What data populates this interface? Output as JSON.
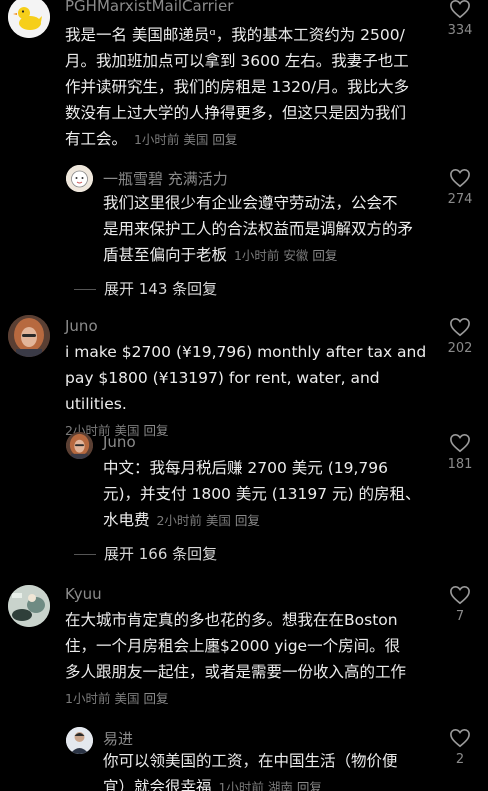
{
  "comments": [
    {
      "username": "PGHMarxistMailCarrier",
      "badge": "ᵅ",
      "text": "我是一名 美国邮递员ᵅ，我的基本工资约为 2500/月。我加班加点可以拿到 3600 左右。我妻子也工作并读研究生，我们的房租是 1320/月。我比大多数没有上过大学的人挣得更多，但这只是因为我们有工会。",
      "lines": [
        "我是一名 美国邮递员ᵅ，我的基本工资约为 2500/",
        "月。我加班加点可以拿到 3600 左右。我妻子也工",
        "作并读研究生，我们的房租是 1320/月。我比大多",
        "数没有上过大学的人挣得更多，但这只是因为我们"
      ],
      "last_line": "有工会。",
      "time": "1小时前",
      "location": "美国",
      "reply_label": "回复",
      "likes": "334"
    },
    {
      "username": "一瓶雪碧 充满活力",
      "lines": [
        "我们这里很少有企业会遵守劳动法，公会不",
        "是用来保护工人的合法权益而是调解双方的矛"
      ],
      "last_line": "盾甚至偏向于老板",
      "time": "1小时前",
      "location": "安徽",
      "reply_label": "回复",
      "likes": "274"
    },
    {
      "expand_label": "展开 143 条回复"
    },
    {
      "username": "Juno",
      "lines": [
        "i make $2700 (¥19,796) monthly after tax and",
        "pay $1800 (¥13197) for rent, water, and utilities."
      ],
      "time": "2小时前",
      "location": "美国",
      "reply_label": "回复",
      "likes": "202"
    },
    {
      "username": "Juno",
      "lines": [
        "中文：我每月税后赚 2700 美元 (19,796",
        "元)，并支付 1800 美元 (13197 元) 的房租、"
      ],
      "last_line": "水电费",
      "time": "2小时前",
      "location": "美国",
      "reply_label": "回复",
      "likes": "181"
    },
    {
      "expand_label": "展开 166 条回复"
    },
    {
      "username": "Kyuu",
      "lines": [
        "在大城市肯定真的多也花的多。想我在在Boston",
        "住，一个月房租会上廛$2000 yige一个房间。很",
        "多人跟朋友一起住，或者是需要一份收入高的工作"
      ],
      "time": "1小时前",
      "location": "美国",
      "reply_label": "回复",
      "likes": "7"
    },
    {
      "username": "易进",
      "lines": [
        "你可以领美国的工资，在中国生活（物价便"
      ],
      "last_line": "宜）就会很幸福",
      "time": "1小时前",
      "location": "湖南",
      "reply_label": "回复",
      "likes": "2"
    }
  ]
}
